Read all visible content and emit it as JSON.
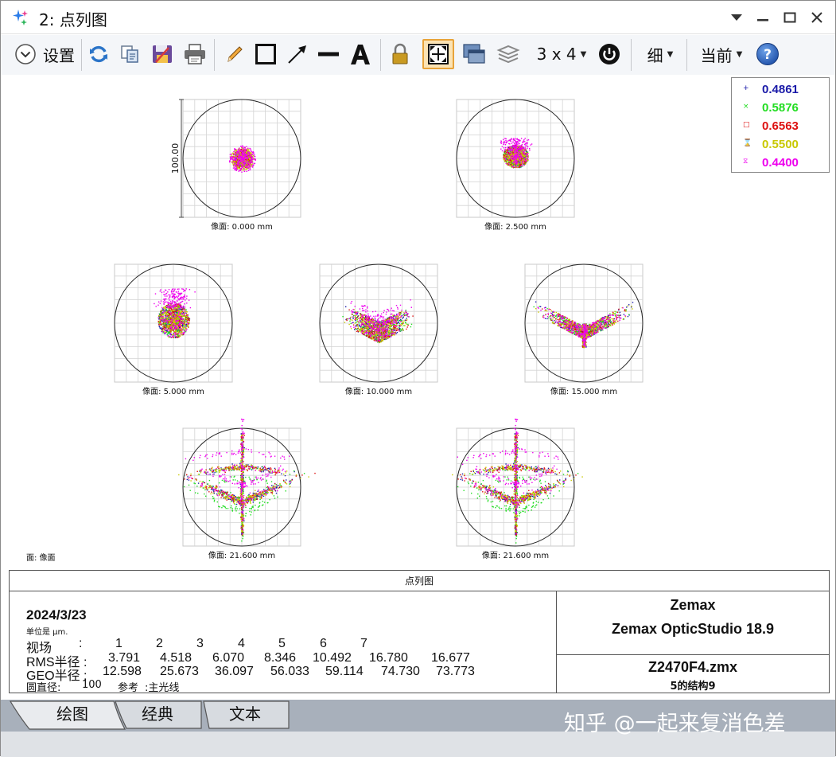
{
  "window": {
    "title": "2: 点列图"
  },
  "toolbar": {
    "settings_label": "设置",
    "layout_label": "3 x 4",
    "line_label": "细",
    "config_label": "当前"
  },
  "legend": [
    {
      "symbol": "+",
      "value": "0.4861",
      "color": "#1a1aa8"
    },
    {
      "symbol": "×",
      "value": "0.5876",
      "color": "#22dd22"
    },
    {
      "symbol": "□",
      "value": "0.6563",
      "color": "#dd1111"
    },
    {
      "symbol": "⌛",
      "value": "0.5500",
      "color": "#c8c800"
    },
    {
      "symbol": "⧖",
      "value": "0.4400",
      "color": "#ee00ee"
    }
  ],
  "spots": {
    "scale_label": "100.00",
    "surface_label": "面: 像面",
    "fields": [
      {
        "label": "像面: 0.000 mm"
      },
      {
        "label": "像面: 2.500 mm"
      },
      {
        "label": "像面: 5.000 mm"
      },
      {
        "label": "像面: 10.000 mm"
      },
      {
        "label": "像面: 15.000 mm"
      },
      {
        "label": "像面: 21.600 mm"
      },
      {
        "label": "像面: 21.600 mm"
      }
    ]
  },
  "info": {
    "title": "点列图",
    "date": "2024/3/23",
    "units": "单位是 µm.",
    "field_label": "视场",
    "colon": ":",
    "field_numbers": [
      "1",
      "2",
      "3",
      "4",
      "5",
      "6",
      "7"
    ],
    "rms_label": "RMS半径 :",
    "rms_values": [
      "3.791",
      "4.518",
      "6.070",
      "8.346",
      "10.492",
      "16.780",
      "16.677"
    ],
    "geo_label": "GEO半径 :",
    "geo_values": [
      "12.598",
      "25.673",
      "36.097",
      "56.033",
      "59.114",
      "74.730",
      "73.773"
    ],
    "circle_label": "圆直径:",
    "circle_value": "100",
    "ref_label": "参考",
    "ref_value": ":主光线",
    "company": "Zemax",
    "product": "Zemax OpticStudio 18.9",
    "file": "Z2470F4.zmx",
    "config": "5的结构9"
  },
  "tabs": [
    "绘图",
    "经典",
    "文本"
  ],
  "watermark": "知乎 @一起来复消色差"
}
